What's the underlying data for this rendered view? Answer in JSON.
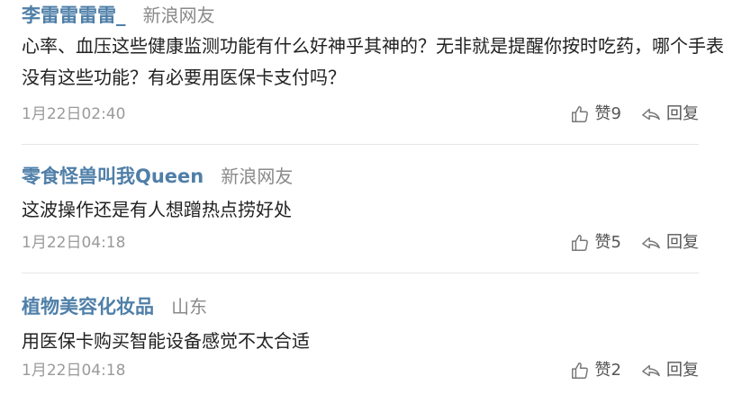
{
  "comments": [
    {
      "username": "李雷雷雷雷_",
      "user_tag": "新浪网友",
      "text": "心率、血压这些健康监测功能有什么好神乎其神的？无非就是提醒你按时吃药，哪个手表没有这些功能？有必要用医保卡支付吗？",
      "time": "1月22日02:40",
      "like_label": "赞9",
      "reply_label": "回复"
    },
    {
      "username": "零食怪兽叫我Queen",
      "user_tag": "新浪网友",
      "text": "这波操作还是有人想蹭热点捞好处",
      "time": "1月22日04:18",
      "like_label": "赞5",
      "reply_label": "回复"
    },
    {
      "username": "植物美容化妆品",
      "user_tag": "山东",
      "text": "用医保卡购买智能设备感觉不太合适",
      "time": "1月22日04:18",
      "like_label": "赞2",
      "reply_label": "回复"
    }
  ],
  "icons": {
    "like": "thumbs-up-icon",
    "reply": "reply-arrow-icon"
  },
  "colors": {
    "username": "#4f7fa8",
    "user_tag": "#8a8a8a",
    "text": "#222222",
    "time": "#9a9a9a",
    "action": "#555555",
    "divider": "#e6e6e6"
  }
}
